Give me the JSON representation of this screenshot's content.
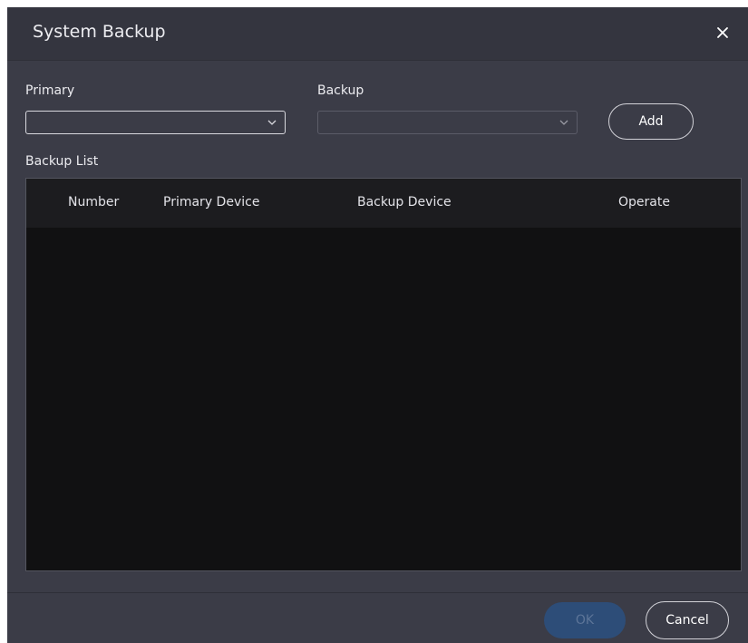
{
  "dialog": {
    "title": "System Backup",
    "close_icon": "close-icon"
  },
  "form": {
    "primary_label": "Primary",
    "primary_value": "",
    "backup_label": "Backup",
    "backup_value": "",
    "add_label": "Add",
    "dropdown_icon": "chevron-down-icon"
  },
  "backup_list": {
    "label": "Backup List",
    "columns": [
      "Number",
      "Primary Device",
      "Backup Device",
      "Operate"
    ],
    "rows": []
  },
  "footer": {
    "ok_label": "OK",
    "cancel_label": "Cancel"
  },
  "colors": {
    "dialog_bg": "#3b3c47",
    "table_bg": "#111112",
    "ok_disabled": "#2d4d78"
  }
}
